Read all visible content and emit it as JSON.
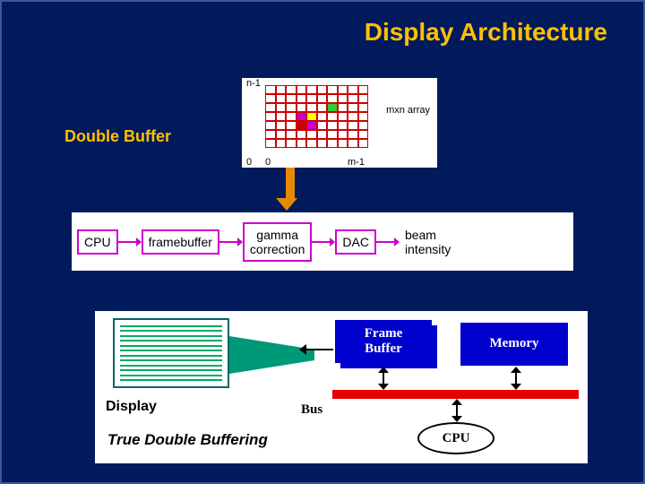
{
  "title": "Display Architecture",
  "subtitle": "Double Buffer",
  "grid": {
    "y_max_label": "n-1",
    "origin_y": "0",
    "origin_x": "0",
    "x_max_label": "m-1",
    "right_label": "mxn array",
    "filled_cells": [
      {
        "row": 2,
        "col": 6,
        "color": "#33cc33"
      },
      {
        "row": 3,
        "col": 3,
        "color": "#cc00cc"
      },
      {
        "row": 3,
        "col": 4,
        "color": "#ffff00"
      },
      {
        "row": 4,
        "col": 3,
        "color": "#cc0000"
      },
      {
        "row": 4,
        "col": 4,
        "color": "#cc00cc"
      }
    ]
  },
  "pipeline": {
    "box1": "CPU",
    "box2": "framebuffer",
    "box3": "gamma\ncorrection",
    "box4": "DAC",
    "out_label": "beam\nintensity"
  },
  "system": {
    "display_label": "Display",
    "frame_buffer_label": "Frame\nBuffer",
    "memory_label": "Memory",
    "bus_label": "Bus",
    "cpu_label": "CPU",
    "footer_label": "True Double Buffering"
  }
}
